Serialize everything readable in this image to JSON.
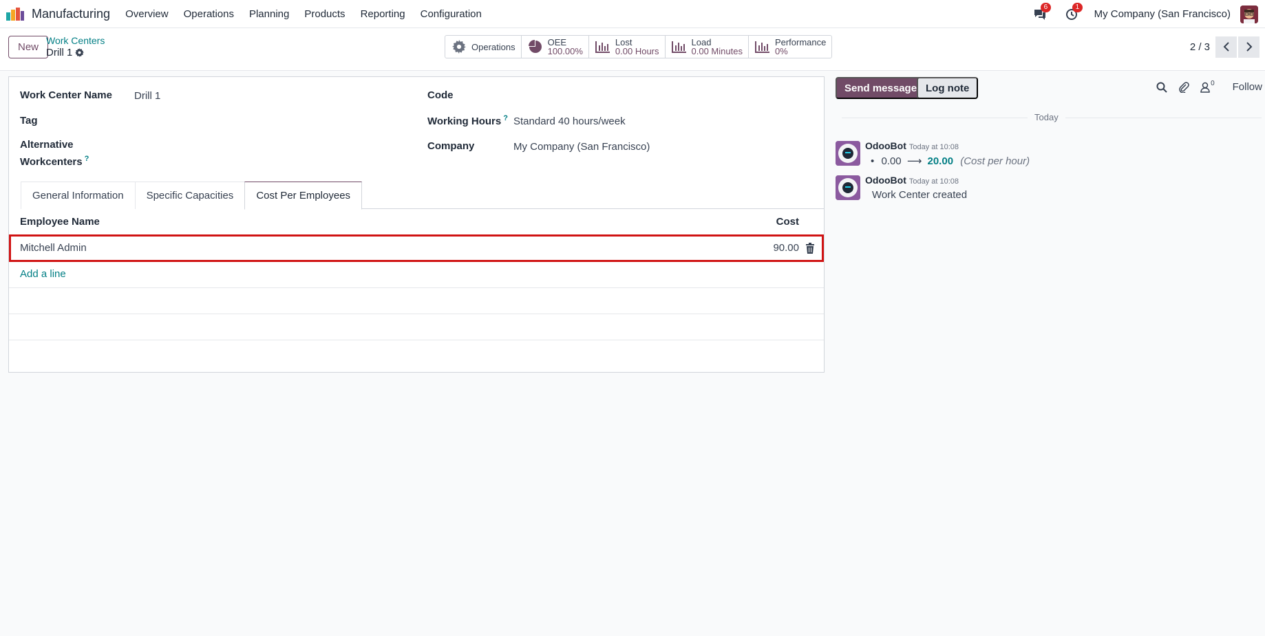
{
  "navbar": {
    "app_name": "Manufacturing",
    "menu": [
      "Overview",
      "Operations",
      "Planning",
      "Products",
      "Reporting",
      "Configuration"
    ],
    "messages_badge": "6",
    "activities_badge": "1",
    "company": "My Company (San Francisco)"
  },
  "control": {
    "new_label": "New",
    "breadcrumb_parent": "Work Centers",
    "breadcrumb_current": "Drill 1",
    "smart_buttons": {
      "operations": {
        "label": "Operations"
      },
      "oee": {
        "label": "OEE",
        "value": "100.00%"
      },
      "lost": {
        "label": "Lost",
        "value": "0.00 Hours"
      },
      "load": {
        "label": "Load",
        "value": "0.00 Minutes"
      },
      "performance": {
        "label": "Performance",
        "value": "0%"
      }
    },
    "pager": "2 / 3"
  },
  "form": {
    "work_center_name_label": "Work Center Name",
    "work_center_name_value": "Drill 1",
    "tag_label": "Tag",
    "alternative_label_line1": "Alternative",
    "alternative_label_line2": "Workcenters",
    "code_label": "Code",
    "working_hours_label": "Working Hours",
    "working_hours_value": "Standard 40 hours/week",
    "company_label": "Company",
    "company_value": "My Company (San Francisco)",
    "help_mark": "?",
    "tabs": [
      "General Information",
      "Specific Capacities",
      "Cost Per Employees"
    ],
    "table": {
      "headers": {
        "employee": "Employee Name",
        "cost": "Cost"
      },
      "rows": [
        {
          "employee": "Mitchell Admin",
          "cost": "90.00"
        }
      ],
      "add_line": "Add a line"
    }
  },
  "chatter": {
    "send_message": "Send message",
    "log_note": "Log note",
    "followers_count": "0",
    "follow": "Follow",
    "date_label": "Today",
    "messages": [
      {
        "author": "OdooBot",
        "time": "Today at 10:08",
        "old_value": "0.00",
        "arrow": "⟶",
        "new_value": "20.00",
        "field": "(Cost per hour)"
      },
      {
        "author": "OdooBot",
        "time": "Today at 10:08",
        "body": "Work Center created"
      }
    ]
  },
  "colors": {
    "brand": "#714b67",
    "link": "#017e84",
    "highlight": "#d01313"
  }
}
